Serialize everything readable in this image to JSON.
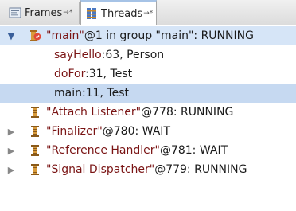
{
  "tabs": [
    {
      "label": "Frames",
      "pin": "→*"
    },
    {
      "label": "Threads",
      "pin": "→*"
    }
  ],
  "main_thread": {
    "name": "\"main\"",
    "rest": "@1 in group \"main\": RUNNING"
  },
  "frames": [
    {
      "method": "sayHello",
      "rest": ":63, Person"
    },
    {
      "method": "doFor",
      "rest": ":31, Test"
    },
    {
      "method": "main",
      "rest": ":11, Test"
    }
  ],
  "threads": [
    {
      "name": "\"Attach Listener\"",
      "rest": "@778: RUNNING",
      "expander": ""
    },
    {
      "name": "\"Finalizer\"",
      "rest": "@780: WAIT",
      "expander": "▶"
    },
    {
      "name": "\"Reference Handler\"",
      "rest": "@781: WAIT",
      "expander": "▶"
    },
    {
      "name": "\"Signal Dispatcher\"",
      "rest": "@779: RUNNING",
      "expander": "▶"
    }
  ],
  "colors": {
    "group_row_bg": "#d6e5f7",
    "selected_frame_bg": "#c6d9f1",
    "string_text": "#7a1414",
    "method_text": "#7a1414"
  }
}
